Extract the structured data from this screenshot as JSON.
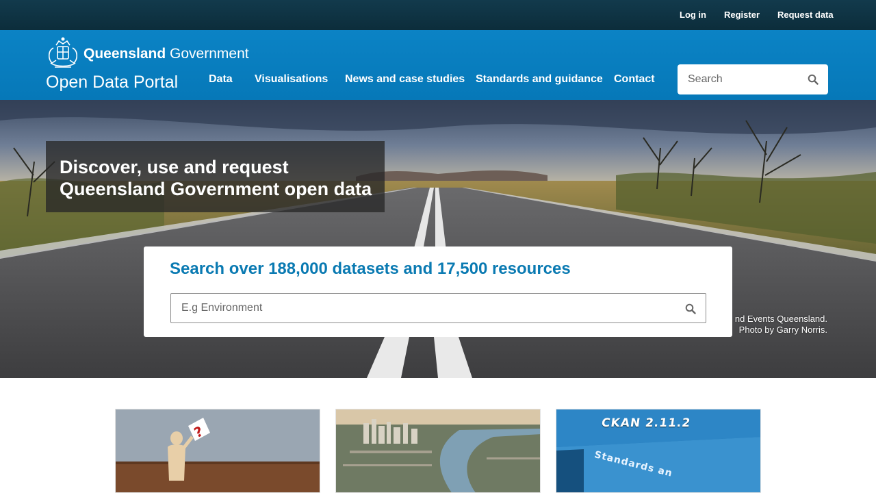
{
  "topbar": {
    "login": "Log in",
    "register": "Register",
    "request_data": "Request data"
  },
  "header": {
    "gov_name_bold": "Queensland",
    "gov_name_rest": "Government",
    "portal_title": "Open Data Portal",
    "nav": [
      "Data",
      "Visualisations",
      "News and case studies",
      "Standards and guidance",
      "Contact"
    ],
    "search_placeholder": "Search"
  },
  "hero": {
    "title": "Discover, use and request Queensland Government open data",
    "credit_line1": "nd Events Queensland.",
    "credit_line2": "Photo by Garry Norris.",
    "search_heading": "Search over 188,000 datasets and 17,500 resources",
    "search_placeholder": "E.g Environment"
  },
  "cards": {
    "card3_ckan": "CKAN 2.11.2",
    "card3_standards": "Standards an"
  },
  "colors": {
    "topbar": "#0e3141",
    "header": "#0a7dc0",
    "heading_accent": "#0a7ab2"
  }
}
